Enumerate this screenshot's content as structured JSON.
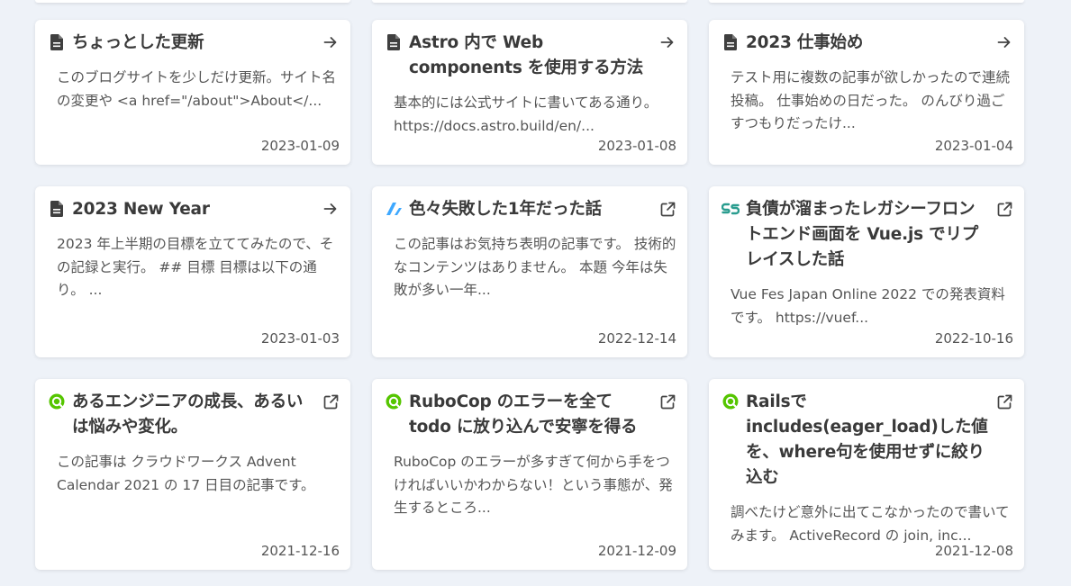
{
  "cards": [
    {
      "source": "document",
      "source_icon": "document-icon",
      "action_icon": "arrow-right-icon",
      "title": "ちょっとした更新",
      "excerpt": "このブログサイトを少しだけ更新。サイト名の変更や <a href=\"/about\">About</...",
      "date": "2023-01-09"
    },
    {
      "source": "document",
      "source_icon": "document-icon",
      "action_icon": "arrow-right-icon",
      "title": "Astro 内で Web components を使用する方法",
      "excerpt": "基本的には公式サイトに書いてある通り。 https://docs.astro.build/en/...",
      "date": "2023-01-08"
    },
    {
      "source": "document",
      "source_icon": "document-icon",
      "action_icon": "arrow-right-icon",
      "title": "2023 仕事始め",
      "excerpt": "テスト用に複数の記事が欲しかったので連続投稿。 仕事始めの日だった。 のんびり過ごすつもりだったけ...",
      "date": "2023-01-04"
    },
    {
      "source": "document",
      "source_icon": "document-icon",
      "action_icon": "arrow-right-icon",
      "title": "2023 New Year",
      "excerpt": "2023 年上半期の目標を立ててみたので、その記録と実行。 ## 目標 目標は以下の通り。 ...",
      "date": "2023-01-03"
    },
    {
      "source": "zenn",
      "source_icon": "zenn-logo-icon",
      "action_icon": "external-link-icon",
      "title": "色々失敗した1年だった話",
      "excerpt": "この記事はお気持ち表明の記事です。 技術的なコンテンツはありません。 本題 今年は失敗が多い一年...",
      "date": "2022-12-14"
    },
    {
      "source": "speakerdeck",
      "source_icon": "speakerdeck-logo-icon",
      "action_icon": "external-link-icon",
      "title": "負債が溜まったレガシーフロントエンド画面を Vue.js でリプレイスした話",
      "excerpt": "Vue Fes Japan Online 2022 での発表資料です。 https://vuef...",
      "date": "2022-10-16"
    },
    {
      "source": "qiita",
      "source_icon": "qiita-logo-icon",
      "action_icon": "external-link-icon",
      "title": "あるエンジニアの成長、あるいは悩みや変化。",
      "excerpt": "この記事は クラウドワークス Advent Calendar 2021 の 17 日目の記事です。",
      "date": "2021-12-16"
    },
    {
      "source": "qiita",
      "source_icon": "qiita-logo-icon",
      "action_icon": "external-link-icon",
      "title": "RuboCop のエラーを全て todo に放り込んで安寧を得る",
      "excerpt": "RuboCop のエラーが多すぎて何から手をつければいいかわからない！という事態が、発生するところ...",
      "date": "2021-12-09"
    },
    {
      "source": "qiita",
      "source_icon": "qiita-logo-icon",
      "action_icon": "external-link-icon",
      "title": "Railsでincludes(eager_load)した値を、where句を使用せずに絞り込む",
      "excerpt": "調べたけど意外に出てこなかったので書いてみます。 ActiveRecord の join, inc...",
      "date": "2021-12-08"
    }
  ]
}
